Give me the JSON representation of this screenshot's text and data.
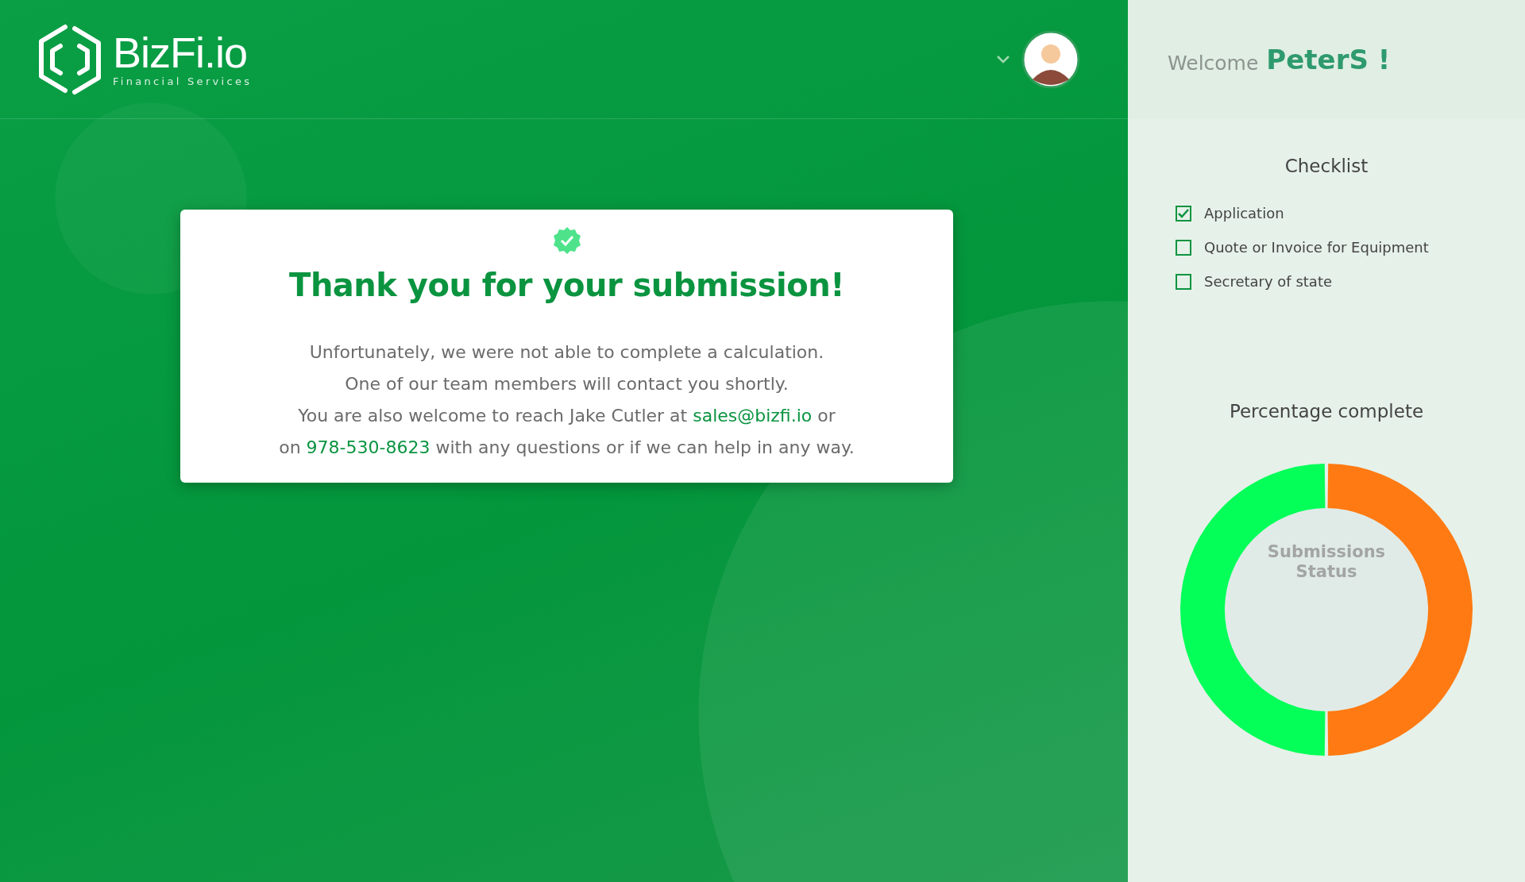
{
  "header": {
    "logo": {
      "name": "BizFi.io",
      "tagline": "Financial Services"
    }
  },
  "card": {
    "title": "Thank you for your submission!",
    "message_lines": [
      [
        {
          "kind": "text",
          "text": "Unfortunately, we were not able to complete a calculation."
        }
      ],
      [
        {
          "kind": "text",
          "text": "One of our team members will contact you shortly."
        }
      ],
      [
        {
          "kind": "text",
          "text": "You are also welcome to reach Jake Cutler at "
        },
        {
          "kind": "link",
          "text": "sales@bizfi.io"
        },
        {
          "kind": "text",
          "text": " or"
        }
      ],
      [
        {
          "kind": "text",
          "text": "on "
        },
        {
          "kind": "link",
          "text": "978-530-8623"
        },
        {
          "kind": "text",
          "text": " with any questions or if we can help in any way."
        }
      ]
    ]
  },
  "sidebar": {
    "welcome": "Welcome",
    "user": "PeterS !",
    "checklist": {
      "title": "Checklist",
      "items": [
        {
          "label": "Application",
          "checked": true
        },
        {
          "label": "Quote or Invoice for Equipment",
          "checked": false
        },
        {
          "label": "Secretary of state",
          "checked": false
        }
      ]
    },
    "progress": {
      "title": "Percentage complete",
      "center_label": "Submissions Status",
      "segments": [
        {
          "color": "#ff7a12"
        },
        {
          "color": "#05ff59"
        }
      ]
    }
  }
}
